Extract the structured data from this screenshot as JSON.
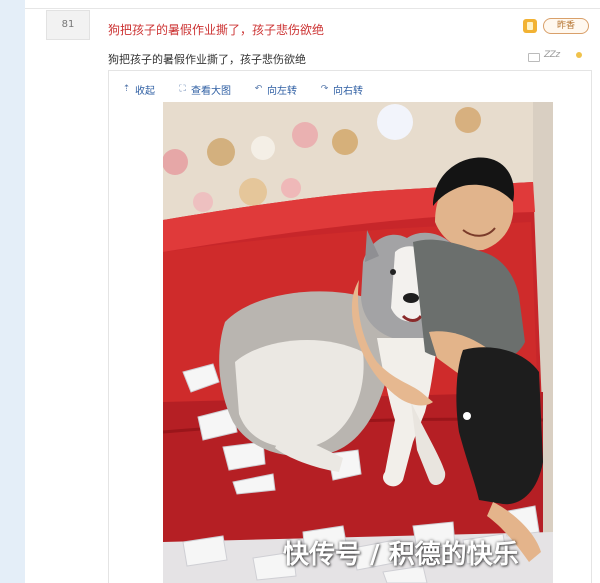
{
  "floor": "81",
  "post": {
    "title": "狗把孩子的暑假作业撕了，孩子悲伤欲绝",
    "text": "狗把孩子的暑假作业撕了，孩子悲伤欲绝"
  },
  "user": {
    "name": "昨香",
    "status": "ZZz"
  },
  "toolbar": {
    "collapse": "收起",
    "view_large": "查看大图",
    "rotate_left": "向左转",
    "rotate_right": "向右转"
  },
  "watermark": "快传号 / 积德的快乐",
  "colors": {
    "title": "#cc3333",
    "link": "#2f5fa3",
    "sidebar": "#e4eef8",
    "sofa": "#cf2b2b"
  },
  "icons": [
    "collapse-arrow-icon",
    "zoom-icon",
    "rotate-left-icon",
    "rotate-right-icon",
    "user-badge-icon",
    "reply-icon"
  ]
}
